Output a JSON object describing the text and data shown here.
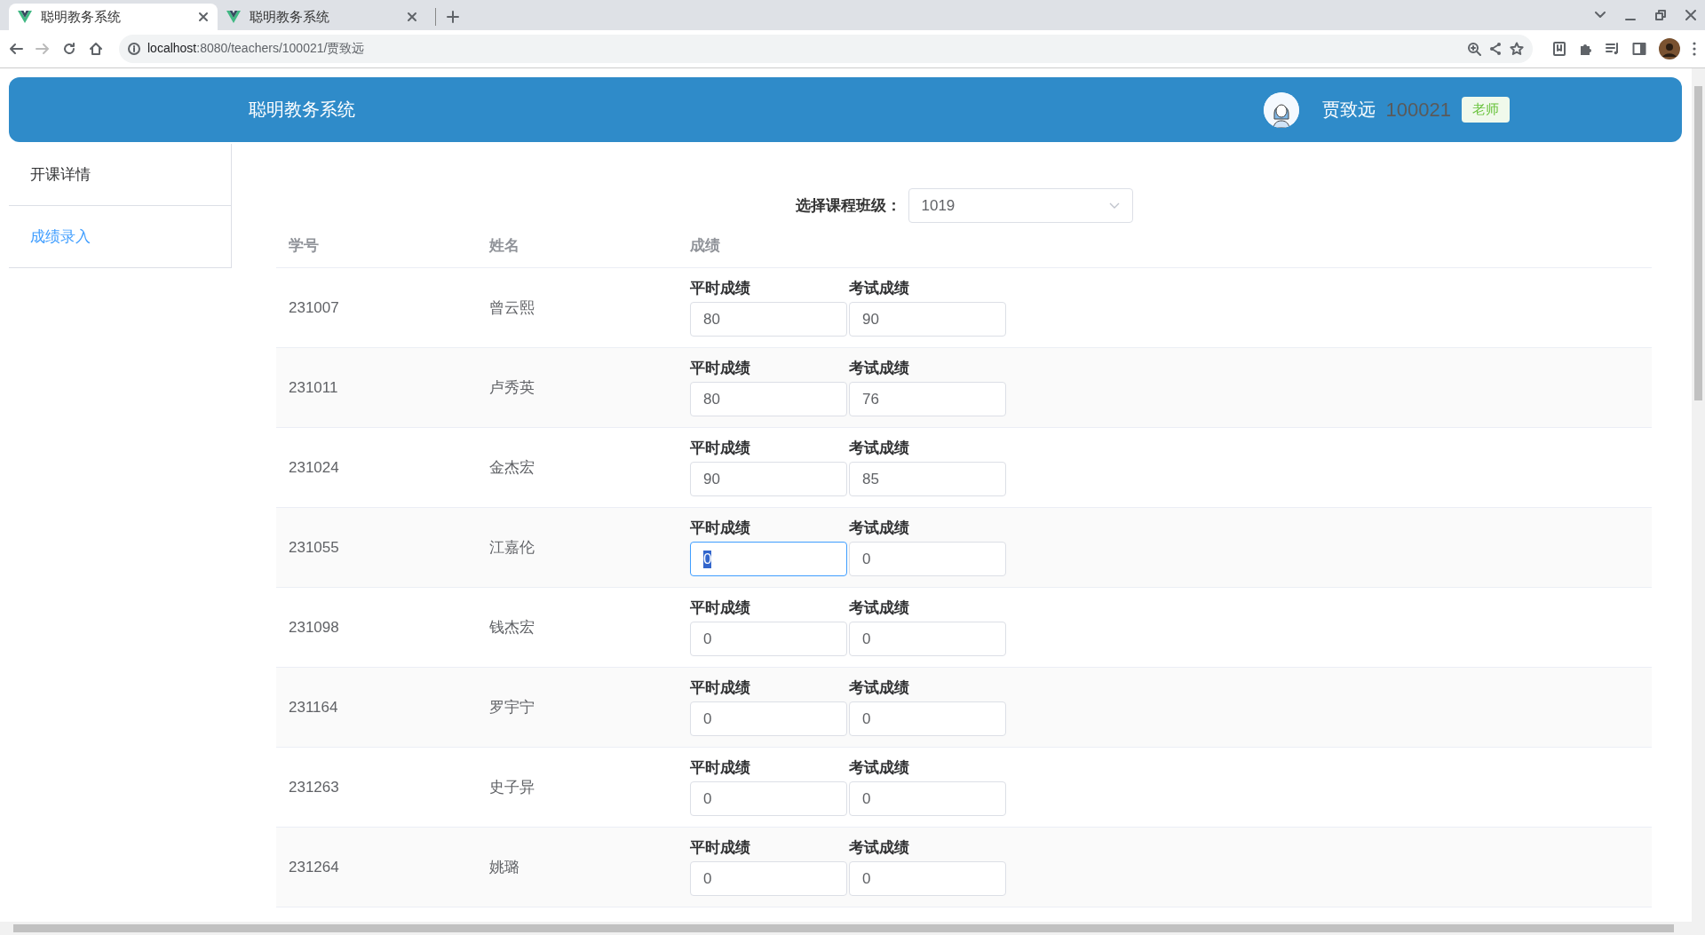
{
  "browser": {
    "tabs": [
      {
        "title": "聪明教务系统",
        "selected": true
      },
      {
        "title": "聪明教务系统",
        "selected": false
      }
    ],
    "url_host": "localhost",
    "url_path": ":8080/teachers/100021/贾致远"
  },
  "header": {
    "title": "聪明教务系统",
    "user_name": "贾致远",
    "user_id": "100021",
    "role": "老师"
  },
  "sidebar": {
    "items": [
      {
        "label": "开课详情",
        "selected": false
      },
      {
        "label": "成绩录入",
        "selected": true
      }
    ]
  },
  "class_select": {
    "label": "选择课程班级：",
    "value": "1019"
  },
  "table": {
    "columns": [
      "学号",
      "姓名",
      "成绩"
    ],
    "rows": [
      {
        "id": "231007",
        "name": "曾云熙",
        "scores": [
          {
            "label": "平时成绩",
            "value": "80",
            "focused": false
          },
          {
            "label": "考试成绩",
            "value": "90",
            "focused": false
          }
        ]
      },
      {
        "id": "231011",
        "name": "卢秀英",
        "scores": [
          {
            "label": "平时成绩",
            "value": "80",
            "focused": false
          },
          {
            "label": "考试成绩",
            "value": "76",
            "focused": false
          }
        ]
      },
      {
        "id": "231024",
        "name": "金杰宏",
        "scores": [
          {
            "label": "平时成绩",
            "value": "90",
            "focused": false
          },
          {
            "label": "考试成绩",
            "value": "85",
            "focused": false
          }
        ]
      },
      {
        "id": "231055",
        "name": "江嘉伦",
        "scores": [
          {
            "label": "平时成绩",
            "value": "0",
            "focused": true
          },
          {
            "label": "考试成绩",
            "value": "0",
            "focused": false
          }
        ]
      },
      {
        "id": "231098",
        "name": "钱杰宏",
        "scores": [
          {
            "label": "平时成绩",
            "value": "0",
            "focused": false
          },
          {
            "label": "考试成绩",
            "value": "0",
            "focused": false
          }
        ]
      },
      {
        "id": "231164",
        "name": "罗宇宁",
        "scores": [
          {
            "label": "平时成绩",
            "value": "0",
            "focused": false
          },
          {
            "label": "考试成绩",
            "value": "0",
            "focused": false
          }
        ]
      },
      {
        "id": "231263",
        "name": "史子异",
        "scores": [
          {
            "label": "平时成绩",
            "value": "0",
            "focused": false
          },
          {
            "label": "考试成绩",
            "value": "0",
            "focused": false
          }
        ]
      },
      {
        "id": "231264",
        "name": "姚璐",
        "scores": [
          {
            "label": "平时成绩",
            "value": "0",
            "focused": false
          },
          {
            "label": "考试成绩",
            "value": "0",
            "focused": false
          }
        ]
      }
    ]
  }
}
